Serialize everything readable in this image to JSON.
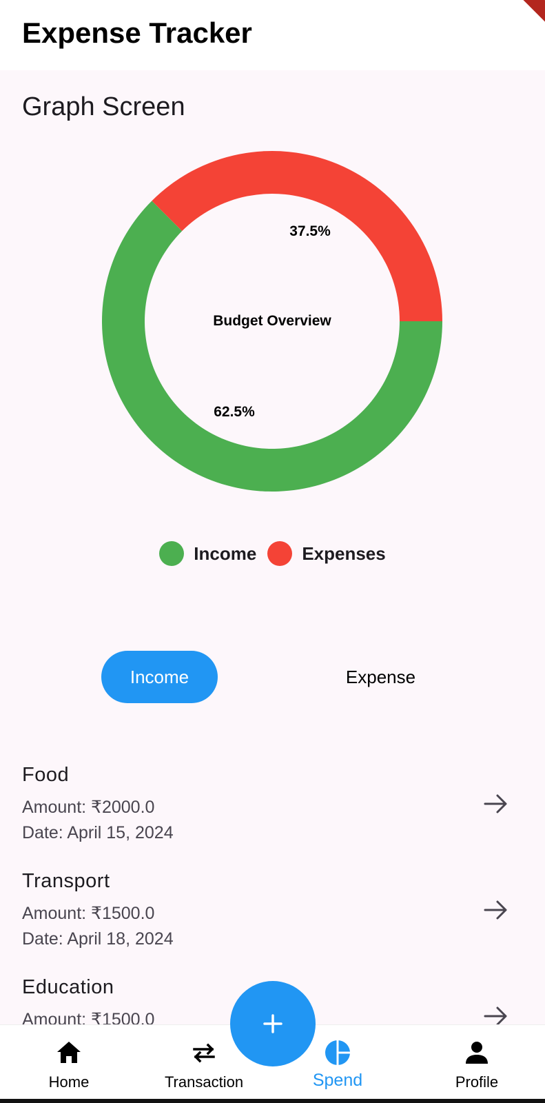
{
  "app": {
    "title": "Expense Tracker"
  },
  "screen": {
    "heading": "Graph Screen"
  },
  "chart_data": {
    "type": "pie",
    "center_label": "Budget Overview",
    "slices": [
      {
        "name": "Income",
        "value": 62.5,
        "label": "62.5%",
        "color": "#4caf50"
      },
      {
        "name": "Expenses",
        "value": 37.5,
        "label": "37.5%",
        "color": "#f44336"
      }
    ],
    "legend": "bottom"
  },
  "legend": {
    "items": [
      {
        "label": "Income",
        "color": "#4caf50"
      },
      {
        "label": "Expenses",
        "color": "#f44336"
      }
    ]
  },
  "toggle": {
    "income_label": "Income",
    "expense_label": "Expense",
    "selected": "Income"
  },
  "transactions": [
    {
      "title": "Food",
      "amount": "Amount: ₹2000.0",
      "date": "Date: April 15, 2024"
    },
    {
      "title": "Transport",
      "amount": "Amount: ₹1500.0",
      "date": "Date: April 18, 2024"
    },
    {
      "title": "Education",
      "amount": "Amount: ₹1500.0",
      "date": ""
    }
  ],
  "nav": {
    "home": "Home",
    "transaction": "Transaction",
    "spend": "Spend",
    "profile": "Profile",
    "active": "Spend"
  },
  "colors": {
    "accent": "#2196f3",
    "income": "#4caf50",
    "expense": "#f44336",
    "background": "#fdf7fb"
  },
  "icons": {
    "fab": "plus-icon",
    "home": "home-icon",
    "transaction": "swap-arrows-icon",
    "spend": "pie-chart-icon",
    "profile": "person-icon",
    "row": "arrow-right-icon"
  }
}
